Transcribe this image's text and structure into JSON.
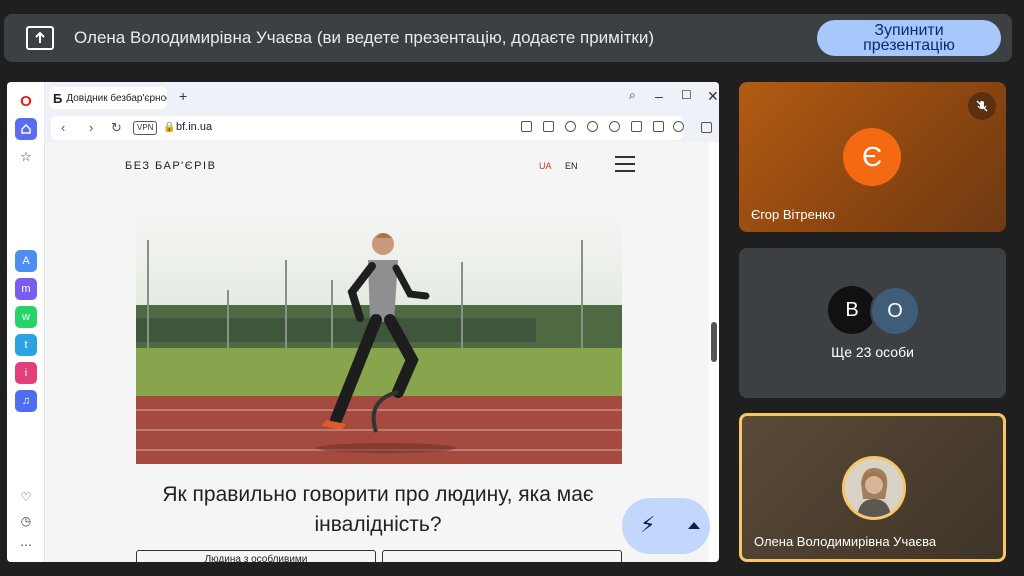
{
  "banner": {
    "title": "Олена Володимирівна Учаєва (ви ведете презентацію, додаєте примітки)",
    "stop_line1": "Зупинити",
    "stop_line2": "презентацію"
  },
  "browser": {
    "tab_favicon": "Б",
    "tab_title": "Довідник безбар'єрності",
    "address_url": "bf.in.ua",
    "vpn_label": "VPN"
  },
  "site": {
    "logo": "БЕЗ БАР'ЄРІВ",
    "lang_ua": "UA",
    "lang_en": "EN",
    "headline": "Як правильно говорити про людину, яка має інвалідність?",
    "button_left": "Людина з особливими"
  },
  "participants": {
    "tile1_initial": "Є",
    "tile1_name": "Єгор Вітренко",
    "tile2_av1": "В",
    "tile2_av2": "О",
    "tile2_label": "Ще 23 особи",
    "tile3_name": "Олена Володимирівна Учаєва"
  },
  "colors": {
    "accent": "#a8c7fa",
    "orange_avatar": "#f36a12",
    "highlight_border": "#f7c66a"
  }
}
